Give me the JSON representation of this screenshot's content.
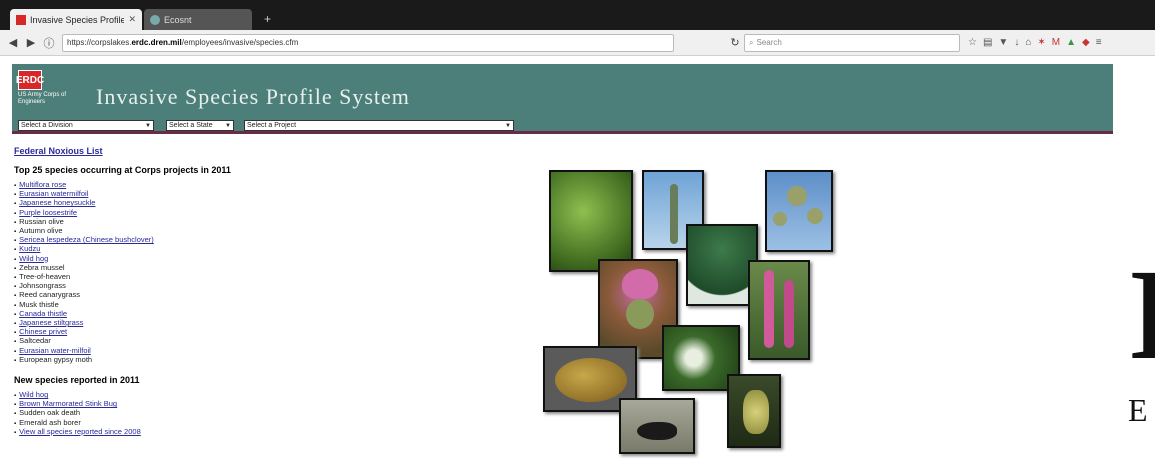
{
  "browser": {
    "tabs": [
      {
        "title": "Invasive Species Profile Syst...",
        "active": true
      },
      {
        "title": "Ecosnt",
        "active": false
      }
    ],
    "url_prefix": "https://corpslakes.",
    "url_domain": "erdc.dren.mil",
    "url_path": "/employees/invasive/species.cfm",
    "search_placeholder": "Search"
  },
  "header": {
    "logo_mark": "ERDC",
    "logo_text": "US Army Corps of Engineers",
    "title": "Invasive Species Profile System",
    "selects": [
      "Select a Division",
      "Select a State",
      "Select a Project"
    ]
  },
  "left": {
    "federal_link": "Federal Noxious List",
    "top_heading": "Top 25 species occurring at Corps projects in 2011",
    "top_species": [
      {
        "name": "Multiflora rose",
        "link": true
      },
      {
        "name": "Eurasian watermilfoil",
        "link": true
      },
      {
        "name": "Japanese honeysuckle",
        "link": true
      },
      {
        "name": "Purple loosestrife",
        "link": true
      },
      {
        "name": "Russian olive",
        "link": false
      },
      {
        "name": "Autumn olive",
        "link": false
      },
      {
        "name": "Sericea lespedeza (Chinese bushclover)",
        "link": true
      },
      {
        "name": "Kudzu",
        "link": true
      },
      {
        "name": "Wild hog",
        "link": true
      },
      {
        "name": "Zebra mussel",
        "link": false
      },
      {
        "name": "Tree-of-heaven",
        "link": false
      },
      {
        "name": "Johnsongrass",
        "link": false
      },
      {
        "name": "Reed canarygrass",
        "link": false
      },
      {
        "name": "Musk thistle",
        "link": false
      },
      {
        "name": "Canada thistle",
        "link": true
      },
      {
        "name": "Japanese stiltgrass",
        "link": true
      },
      {
        "name": "Chinese privet",
        "link": true
      },
      {
        "name": "Saltcedar",
        "link": false
      },
      {
        "name": "Eurasian water-milfoil",
        "link": true
      },
      {
        "name": "European gypsy moth",
        "link": false
      }
    ],
    "new_heading": "New species reported in 2011",
    "new_species": [
      {
        "name": "Wild hog",
        "link": true
      },
      {
        "name": "Brown Marmorated Stink Bug",
        "link": true
      },
      {
        "name": "Sudden oak death",
        "link": false
      },
      {
        "name": "Emerald ash borer",
        "link": false
      },
      {
        "name": "View all species reported since 2008",
        "link": true
      }
    ]
  },
  "right_partial": {
    "big_letter": "I",
    "sub_letter": "E"
  }
}
